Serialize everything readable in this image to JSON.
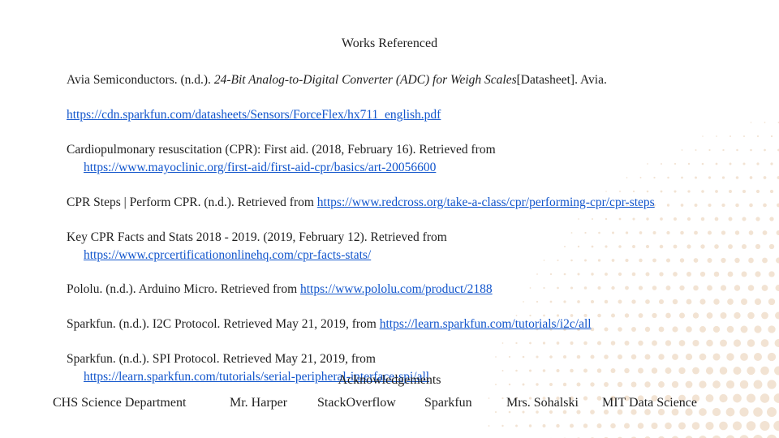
{
  "title": "Works Referenced",
  "references": [
    {
      "pre": "Avia Semiconductors. (n.d.). ",
      "italic": "24-Bit Analog-to-Digital Converter (ADC) for Weigh Scales",
      "post": "[Datasheet]. Avia."
    },
    {
      "link": "https://cdn.sparkfun.com/datasheets/Sensors/ForceFlex/hx711_english.pdf"
    },
    {
      "text": "Cardiopulmonary resuscitation (CPR): First aid. (2018, February 16). Retrieved from",
      "link": "https://www.mayoclinic.org/first-aid/first-aid-cpr/basics/art-20056600"
    },
    {
      "text": "CPR Steps | Perform CPR. (n.d.). Retrieved from ",
      "link": "https://www.redcross.org/take-a-class/cpr/performing-cpr/cpr-steps"
    },
    {
      "text": "Key CPR Facts and Stats 2018 - 2019. (2019, February 12). Retrieved from",
      "link": "https://www.cprcertificationonlinehq.com/cpr-facts-stats/"
    },
    {
      "text": "Pololu. (n.d.). Arduino Micro. Retrieved from ",
      "link": "https://www.pololu.com/product/2188"
    },
    {
      "text": "Sparkfun. (n.d.). I2C Protocol. Retrieved May 21, 2019, from ",
      "link": "https://learn.sparkfun.com/tutorials/i2c/all"
    },
    {
      "text": "Sparkfun. (n.d.). SPI Protocol. Retrieved May 21, 2019, from",
      "link": "https://learn.sparkfun.com/tutorials/serial-peripheral-interface-spi/all"
    }
  ],
  "acknowledgements": {
    "title": "Acknowledgements",
    "names": [
      "CHS Science Department",
      "Mr. Harper",
      "StackOverflow",
      "Sparkfun",
      "Mrs. Sohalski",
      "MIT Data Science"
    ]
  },
  "colors": {
    "link": "#1155cc",
    "dots": "#f2e3d3"
  }
}
